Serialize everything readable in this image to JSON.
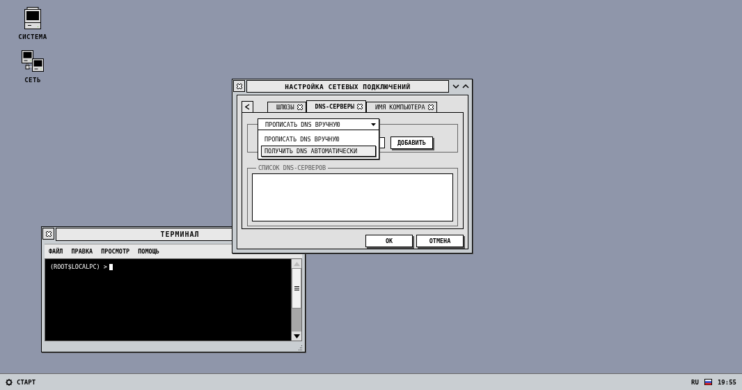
{
  "desktop_icons": [
    {
      "label": "СИСТЕМА",
      "kind": "computer"
    },
    {
      "label": "СЕТЬ",
      "kind": "network"
    }
  ],
  "terminal": {
    "title": "ТЕРМИНАЛ",
    "menu": [
      "ФАЙЛ",
      "ПРАВКА",
      "ПРОСМОТР",
      "ПОМОЩЬ"
    ],
    "prompt": "(ROOT$LOCALPC) >"
  },
  "dialog": {
    "title": "НАСТРОЙКА СЕТЕВЫХ ПОДКЛЮЧЕНИЙ",
    "tabs": [
      {
        "label": "ШЛЮЗЫ",
        "selected": false
      },
      {
        "label": "DNS-СЕРВЕРЫ",
        "selected": true
      },
      {
        "label": "ИМЯ КОМПЬЮТЕРА",
        "selected": false
      }
    ],
    "mode_dropdown": {
      "value": "ПРОПИСАТЬ DNS ВРУЧНУЮ",
      "expanded": true,
      "options": [
        {
          "label": "ПРОПИСАТЬ DNS ВРУЧНУЮ",
          "highlighted": false
        },
        {
          "label": "ПОЛУЧИТЬ DNS АВТОМАТИЧЕСКИ",
          "highlighted": true
        }
      ]
    },
    "add_button": "ДОБАВИТЬ",
    "server_list": {
      "legend": "СПИСОК DNS-СЕРВЕРОВ"
    },
    "buttons": [
      "ОК",
      "ОТМЕНА"
    ]
  },
  "taskbar": {
    "start": "СТАРТ",
    "language": "RU",
    "clock": "19:55"
  }
}
